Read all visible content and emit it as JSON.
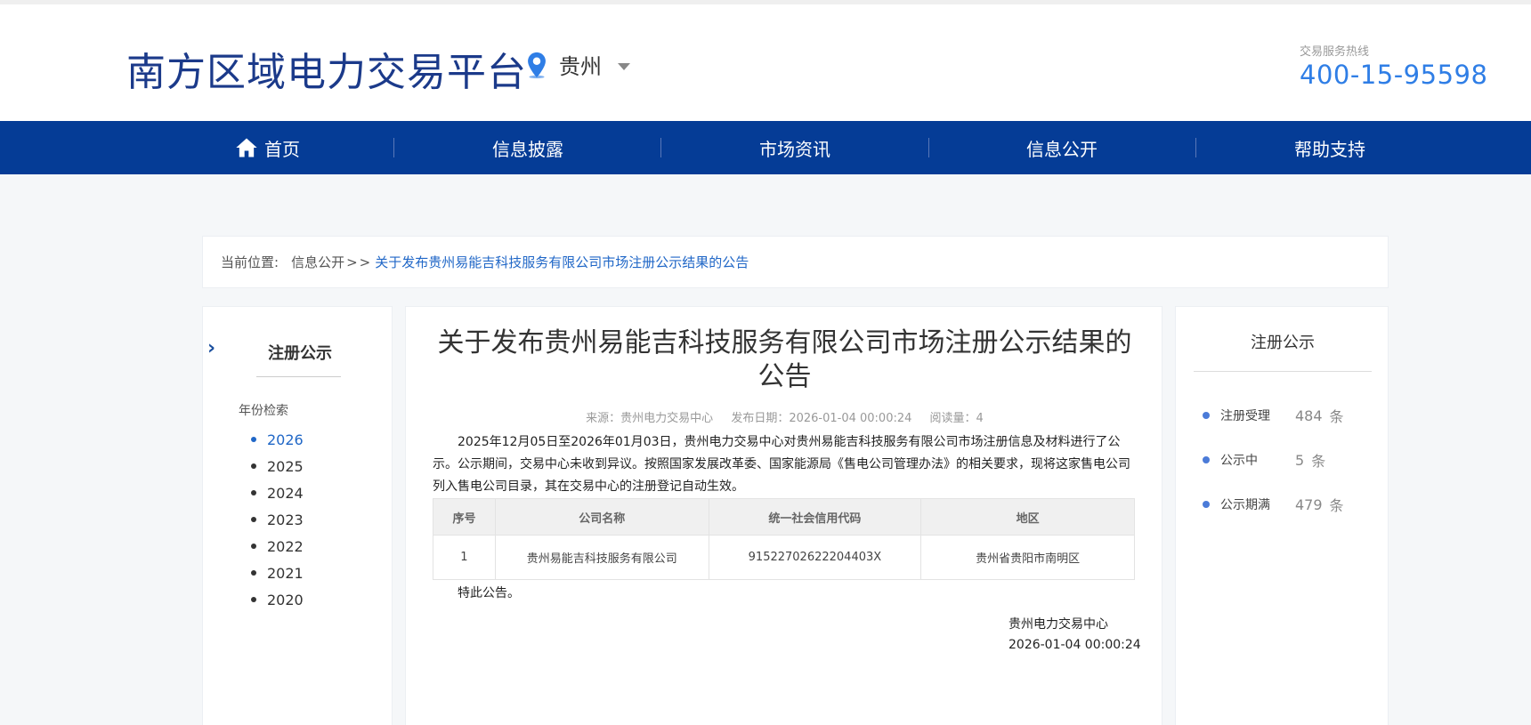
{
  "header": {
    "site_title": "南方区域电力交易平台",
    "region": "贵州",
    "hotline_label": "交易服务热线",
    "hotline_number": "400-15-95598"
  },
  "nav": {
    "items": [
      {
        "label": "首页",
        "icon": "home-icon"
      },
      {
        "label": "信息披露"
      },
      {
        "label": "市场资讯"
      },
      {
        "label": "信息公开"
      },
      {
        "label": "帮助支持"
      }
    ]
  },
  "breadcrumb": {
    "label": "当前位置:",
    "section": "信息公开",
    "separator": ">>",
    "current": "关于发布贵州易能吉科技服务有限公司市场注册公示结果的公告"
  },
  "sidebar": {
    "category": "注册公示",
    "year_label": "年份检索",
    "years": [
      "2026",
      "2025",
      "2024",
      "2023",
      "2022",
      "2021",
      "2020"
    ],
    "active_year": "2026"
  },
  "article": {
    "title": "关于发布贵州易能吉科技服务有限公司市场注册公示结果的公告",
    "meta": {
      "source": "来源：贵州电力交易中心",
      "date": "发布日期：2026-01-04 00:00:24",
      "reads": "阅读量：4"
    },
    "body": "2025年12月05日至2026年01月03日，贵州电力交易中心对贵州易能吉科技服务有限公司市场注册信息及材料进行了公示。公示期间，交易中心未收到异议。按照国家发展改革委、国家能源局《售电公司管理办法》的相关要求，现将这家售电公司列入售电公司目录，其在交易中心的注册登记自动生效。",
    "table": {
      "headers": [
        "序号",
        "公司名称",
        "统一社会信用代码",
        "地区"
      ],
      "rows": [
        [
          "1",
          "贵州易能吉科技服务有限公司",
          "91522702622204403X",
          "贵州省贵阳市南明区"
        ]
      ]
    },
    "closing": "特此公告。",
    "sign_org": "贵州电力交易中心",
    "sign_date": "2026-01-04 00:00:24"
  },
  "stats": {
    "title": "注册公示",
    "items": [
      {
        "label": "注册受理",
        "value": "484",
        "unit": "条"
      },
      {
        "label": "公示中",
        "value": "5",
        "unit": "条"
      },
      {
        "label": "公示期满",
        "value": "479",
        "unit": "条"
      }
    ]
  },
  "colors": {
    "brand_blue": "#1b3a8a",
    "nav_bg": "#053c96",
    "link_blue": "#2067c7",
    "hotline_blue": "#2f7ee6"
  }
}
